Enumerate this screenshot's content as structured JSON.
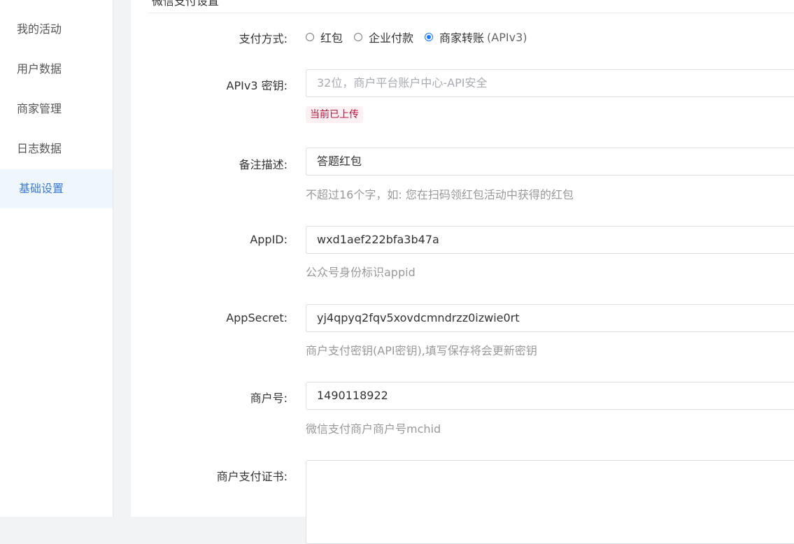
{
  "sidebar": {
    "items": [
      {
        "label": "我的活动"
      },
      {
        "label": "用户数据"
      },
      {
        "label": "商家管理"
      },
      {
        "label": "日志数据"
      },
      {
        "label": "基础设置",
        "active": true
      }
    ]
  },
  "section": {
    "title": "微信支付设置"
  },
  "form": {
    "pay_method": {
      "label": "支付方式:",
      "options": [
        "红包",
        "企业付款",
        "商家转账"
      ],
      "selected": "商家转账",
      "suffix": "(APIv3)"
    },
    "apiv3_key": {
      "label": "APIv3 密钥:",
      "placeholder": "32位，商户平台账户中心-API安全",
      "status_badge": "当前已上传"
    },
    "remark": {
      "label": "备注描述:",
      "value": "答题红包",
      "hint": "不超过16个字，如: 您在扫码领红包活动中获得的红包"
    },
    "appid": {
      "label": "AppID:",
      "value": "wxd1aef222bfa3b47a",
      "hint": "公众号身份标识appid"
    },
    "appsecret": {
      "label": "AppSecret:",
      "value": "yj4qpyq2fqv5xovdcmndrzz0izwie0rt",
      "hint": "商户支付密钥(API密钥),填写保存将会更新密钥"
    },
    "mchid": {
      "label": "商户号:",
      "value": "1490118922",
      "hint": "微信支付商户商户号mchid"
    },
    "cert": {
      "label": "商户支付证书:"
    }
  },
  "colors": {
    "accent": "#1677ff",
    "active_menu_bg": "#f0f6fd",
    "active_menu_text": "#3a7bd5",
    "badge_text": "#b5173f",
    "badge_bg": "#fdf0f3"
  }
}
